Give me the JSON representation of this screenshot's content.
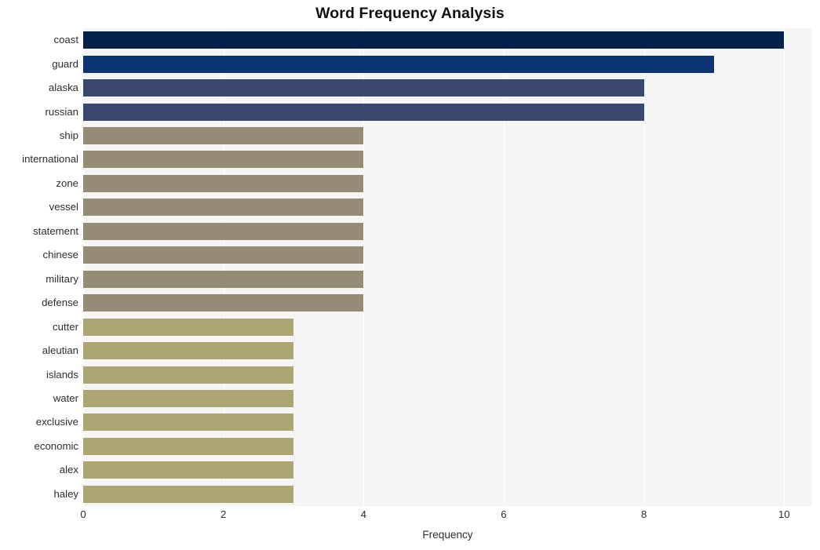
{
  "chart_data": {
    "type": "bar",
    "orientation": "horizontal",
    "title": "Word Frequency Analysis",
    "xlabel": "Frequency",
    "ylabel": "",
    "xlim": [
      0,
      10.4
    ],
    "xticks": [
      0,
      2,
      4,
      6,
      8,
      10
    ],
    "xtick_labels": [
      "0",
      "2",
      "4",
      "6",
      "8",
      "10"
    ],
    "grid": "vertical-white-on-gray",
    "legend": "none",
    "background": "#f5f5f5",
    "categories": [
      "coast",
      "guard",
      "alaska",
      "russian",
      "ship",
      "international",
      "zone",
      "vessel",
      "statement",
      "chinese",
      "military",
      "defense",
      "cutter",
      "aleutian",
      "islands",
      "water",
      "exclusive",
      "economic",
      "alex",
      "haley"
    ],
    "values": [
      10,
      9,
      8,
      8,
      4,
      4,
      4,
      4,
      4,
      4,
      4,
      4,
      3,
      3,
      3,
      3,
      3,
      3,
      3,
      3
    ],
    "bar_colors": [
      "#04234a",
      "#0b3470",
      "#3a4870",
      "#3a4870",
      "#948c74",
      "#948c74",
      "#948c74",
      "#948c74",
      "#948c74",
      "#948c74",
      "#948c74",
      "#948c74",
      "#ada572",
      "#ada572",
      "#ada572",
      "#ada572",
      "#ada572",
      "#ada572",
      "#ada572",
      "#ada572"
    ]
  }
}
